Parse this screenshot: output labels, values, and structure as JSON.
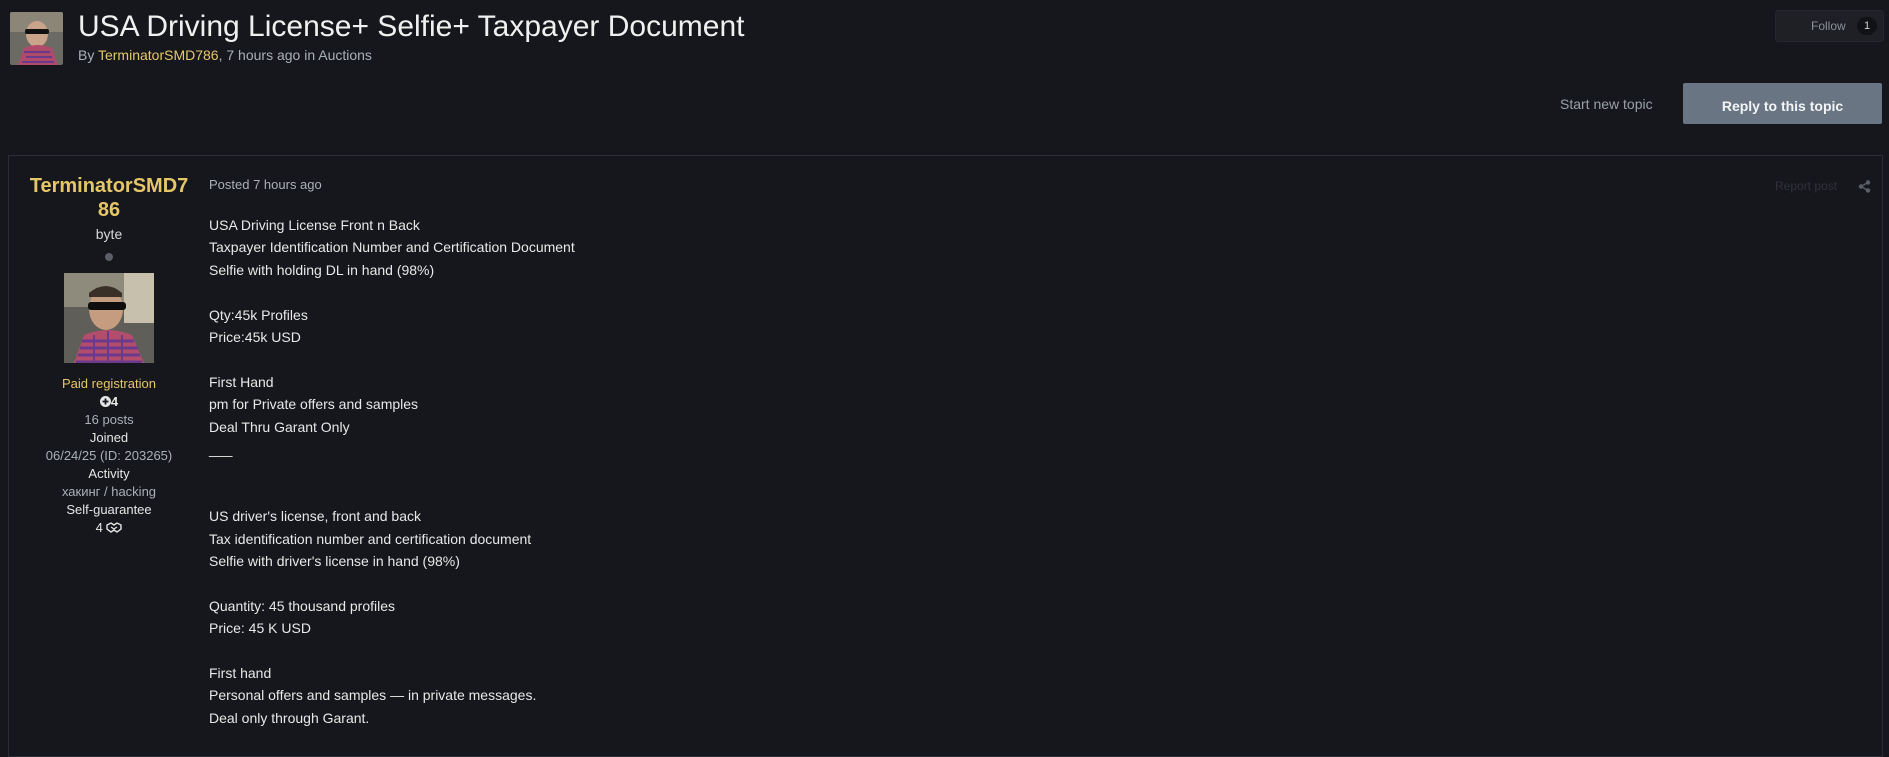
{
  "topic": {
    "title": "USA Driving License+ Selfie+ Taxpayer Document",
    "by_label": "By",
    "author": "TerminatorSMD786",
    "time": ", 7 hours ago in",
    "forum": "Auctions"
  },
  "follow": {
    "label": "Follow",
    "count": "1"
  },
  "actions": {
    "start_new_topic": "Start new topic",
    "reply": "Reply to this topic"
  },
  "post": {
    "author": {
      "name": "TerminatorSMD786",
      "rank": "byte",
      "group": "Paid registration",
      "reputation": "4",
      "posts": "16 posts",
      "joined_label": "Joined",
      "joined_value": "06/24/25 (ID: 203265)",
      "activity_label": "Activity",
      "activity_value": "хакинг / hacking",
      "self_guarantee_label": "Self-guarantee",
      "self_guarantee_value": "4"
    },
    "meta": "Posted 7 hours ago",
    "report": "Report post",
    "lines": [
      "USA Driving License Front n Back",
      "Taxpayer Identification Number and Certification Document",
      "Selfie with holding DL in hand (98%)",
      "",
      "Qty:45k Profiles",
      "Price:45k USD",
      "",
      "First Hand",
      "pm for Private offers and samples",
      "Deal Thru Garant Only",
      "___",
      "",
      "",
      "US driver's license, front and back",
      "Tax identification number and certification document",
      "Selfie with driver's license in hand (98%)",
      "",
      "Quantity: 45 thousand profiles",
      "Price: 45 K USD",
      "",
      "First hand",
      "Personal offers and samples — in private messages.",
      "Deal only through Garant."
    ]
  },
  "icons": {
    "reputation": "plus-circle-icon",
    "self_guarantee": "handshake-icon",
    "share": "share-icon",
    "status": "offline-dot-icon"
  }
}
